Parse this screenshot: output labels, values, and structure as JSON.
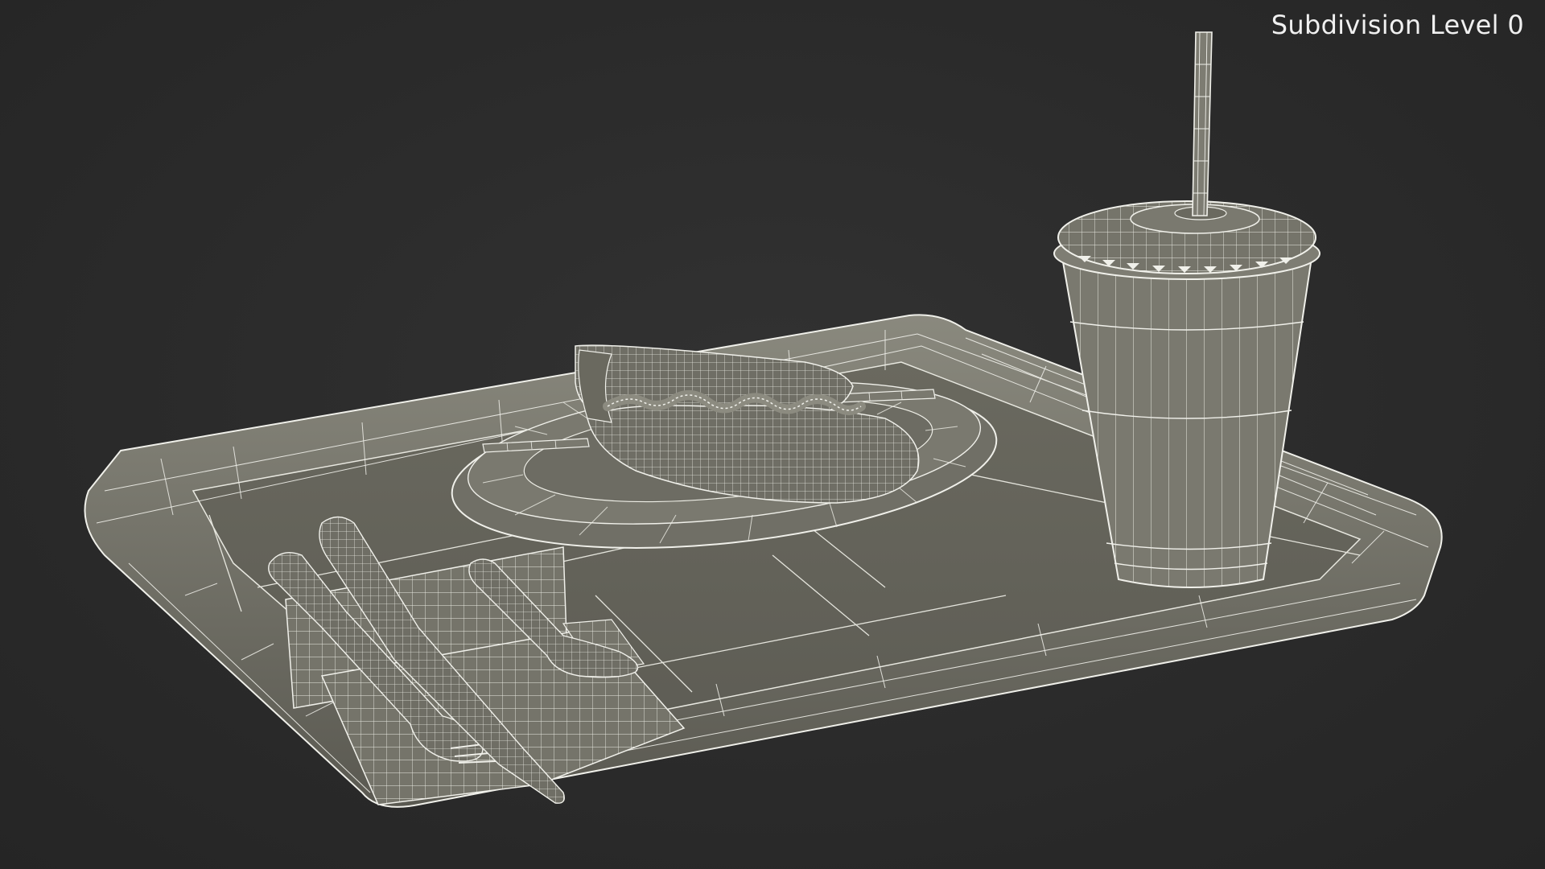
{
  "viewport": {
    "overlay_text": "Subdivision Level 0",
    "background_color": "#2b2b2b",
    "model_color": "#6c6b62",
    "wire_color": "#f2f2ec"
  },
  "scene_objects": [
    "tray",
    "plate",
    "corn-dog",
    "stick",
    "cup",
    "lid",
    "straw",
    "napkin",
    "fork",
    "spoon",
    "knife"
  ]
}
